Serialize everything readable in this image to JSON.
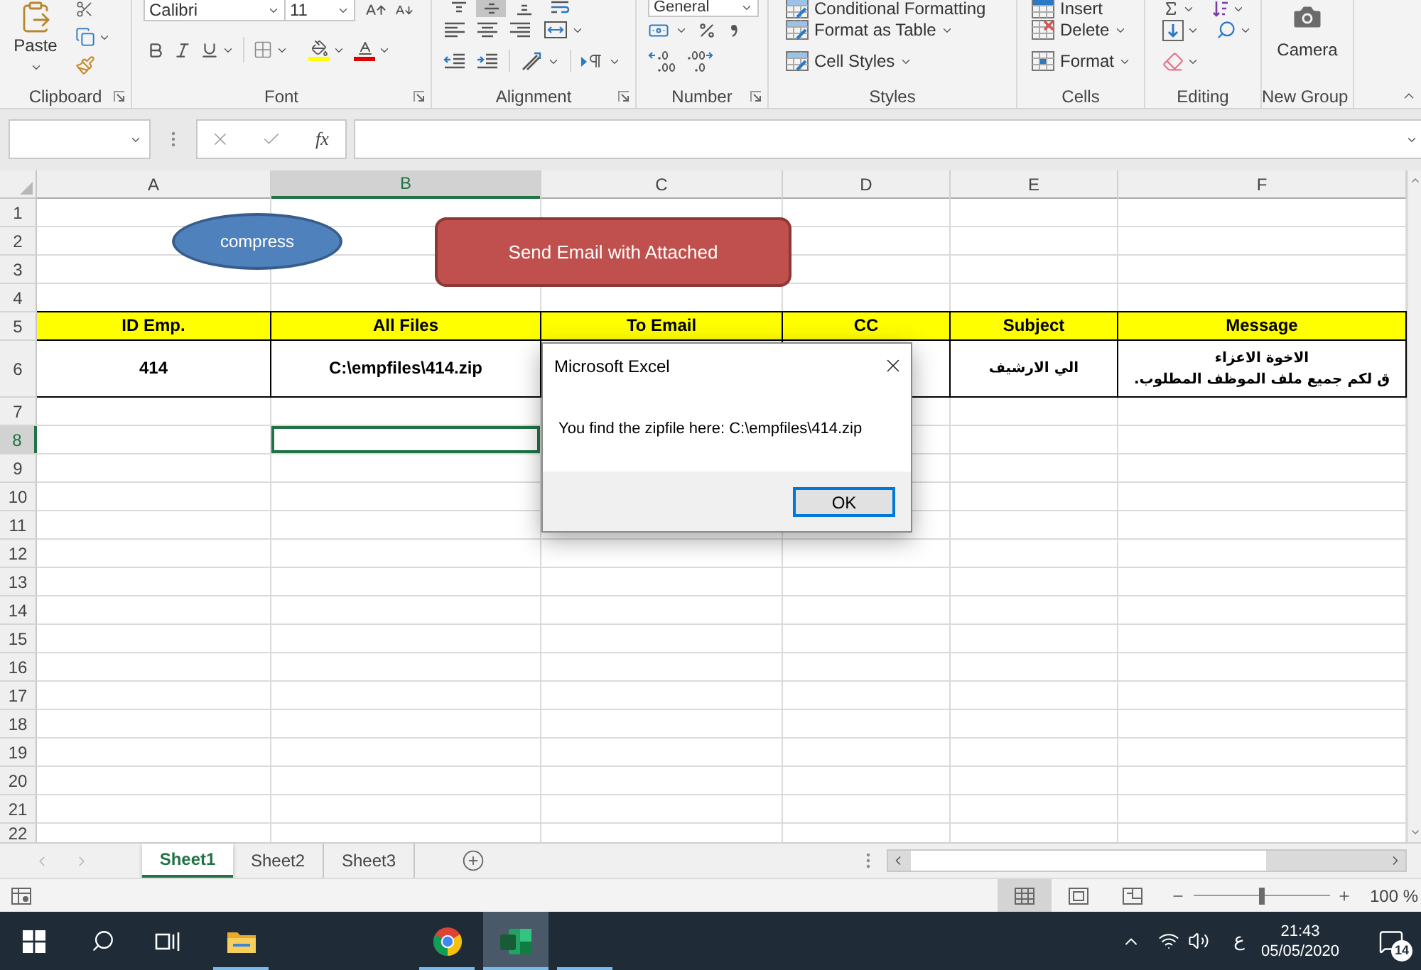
{
  "ribbon": {
    "groups": [
      {
        "kind": "clipboard",
        "label": "Clipboard",
        "launcher": true,
        "paste_label": "Paste"
      },
      {
        "kind": "font",
        "label": "Font",
        "launcher": true,
        "font_name": "Calibri",
        "font_size": "11"
      },
      {
        "kind": "alignment",
        "label": "Alignment",
        "launcher": true,
        "vertical_align": [
          {
            "selected": false
          },
          {
            "selected": true
          },
          {
            "selected": false
          }
        ]
      },
      {
        "kind": "number",
        "label": "Number",
        "launcher": true,
        "format": "General"
      },
      {
        "kind": "styles",
        "label": "Styles",
        "launcher": false,
        "commands": [
          {
            "label": "Conditional Formatting",
            "dropdown": false
          },
          {
            "label": "Format as Table",
            "dropdown": true
          },
          {
            "label": "Cell Styles",
            "dropdown": true
          }
        ]
      },
      {
        "kind": "cells",
        "label": "Cells",
        "launcher": false,
        "commands": [
          {
            "label": "Insert",
            "dropdown": false
          },
          {
            "label": "Delete",
            "dropdown": true
          },
          {
            "label": "Format",
            "dropdown": true
          }
        ]
      },
      {
        "kind": "editing",
        "label": "Editing",
        "launcher": false
      },
      {
        "kind": "camera",
        "label": "New Group",
        "launcher": false,
        "button_label": "Camera"
      }
    ]
  },
  "formula_bar": {
    "function_label": "fx"
  },
  "sheet": {
    "columns": [
      {
        "label": "A",
        "selected": false
      },
      {
        "label": "B",
        "selected": true
      },
      {
        "label": "C",
        "selected": false
      },
      {
        "label": "D",
        "selected": false
      },
      {
        "label": "E",
        "selected": false
      },
      {
        "label": "F",
        "selected": false
      }
    ],
    "rows": [
      {
        "label": "1",
        "selected": false,
        "kind": "blank"
      },
      {
        "label": "2",
        "selected": false,
        "kind": "blank"
      },
      {
        "label": "3",
        "selected": false,
        "kind": "blank"
      },
      {
        "label": "4",
        "selected": false,
        "kind": "blank"
      },
      {
        "label": "5",
        "selected": false,
        "kind": "header",
        "cells": [
          {
            "text": "ID Emp."
          },
          {
            "text": "All Files"
          },
          {
            "text": "To Email"
          },
          {
            "text": "CC"
          },
          {
            "text": "Subject"
          },
          {
            "text": "Message"
          }
        ]
      },
      {
        "label": "6",
        "selected": false,
        "kind": "data",
        "cells": [
          {
            "text": "414"
          },
          {
            "text": "C:\\empfiles\\414.zip"
          },
          null,
          null,
          {
            "text": "الي الارشيف"
          },
          {
            "text": "الاخوة الاعزاء\nق لكم جميع ملف الموظف المطلوب."
          }
        ]
      },
      {
        "label": "7",
        "selected": false,
        "kind": "blank"
      },
      {
        "label": "8",
        "selected": true,
        "kind": "blank"
      },
      {
        "label": "9",
        "selected": false,
        "kind": "blank"
      },
      {
        "label": "10",
        "selected": false,
        "kind": "blank"
      },
      {
        "label": "11",
        "selected": false,
        "kind": "blank"
      },
      {
        "label": "12",
        "selected": false,
        "kind": "blank"
      },
      {
        "label": "13",
        "selected": false,
        "kind": "blank"
      },
      {
        "label": "14",
        "selected": false,
        "kind": "blank"
      },
      {
        "label": "15",
        "selected": false,
        "kind": "blank"
      },
      {
        "label": "16",
        "selected": false,
        "kind": "blank"
      },
      {
        "label": "17",
        "selected": false,
        "kind": "blank"
      },
      {
        "label": "18",
        "selected": false,
        "kind": "blank"
      },
      {
        "label": "19",
        "selected": false,
        "kind": "blank"
      },
      {
        "label": "20",
        "selected": false,
        "kind": "blank"
      },
      {
        "label": "21",
        "selected": false,
        "kind": "blank"
      },
      {
        "label": "22",
        "selected": false,
        "kind": "blank"
      }
    ]
  },
  "shapes": [
    {
      "kind": "ellipse",
      "label": "compress"
    },
    {
      "kind": "rounded_rect",
      "label": "Send Email with Attached"
    }
  ],
  "dialog": {
    "title": "Microsoft Excel",
    "message": "You find the zipfile here: C:\\empfiles\\414.zip",
    "buttons": [
      {
        "label": "OK",
        "focused": true
      }
    ]
  },
  "sheet_tabs": [
    {
      "label": "Sheet1",
      "selected": true
    },
    {
      "label": "Sheet2",
      "selected": false
    },
    {
      "label": "Sheet3",
      "selected": false
    }
  ],
  "status_bar": {
    "views": [
      {
        "kind": "normal",
        "selected": true
      },
      {
        "kind": "page_layout",
        "selected": false
      },
      {
        "kind": "page_break",
        "selected": false
      }
    ],
    "zoom": {
      "level": 0.5,
      "reading": "100 %"
    }
  },
  "taskbar": {
    "apps": [
      {
        "kind": "folder",
        "running": true,
        "active": false
      },
      {
        "kind": "browser",
        "running": true,
        "active": false
      },
      {
        "kind": "spreadsheet",
        "running": true,
        "active": true
      },
      {
        "kind": "blank",
        "running": true,
        "active": false
      }
    ],
    "tray": {
      "language": "ع",
      "time": "21:43",
      "date": "05/05/2020",
      "notifications": "14"
    }
  }
}
